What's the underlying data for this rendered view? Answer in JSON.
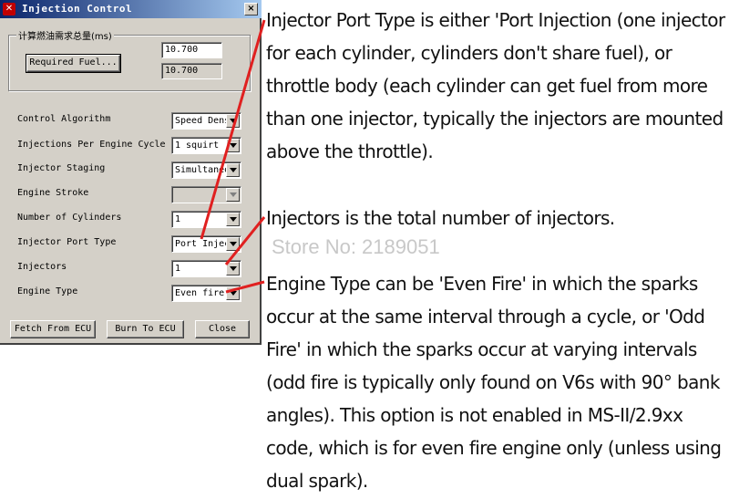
{
  "window": {
    "title": "Injection Control",
    "close_label": "×"
  },
  "required_fuel": {
    "group_label": "计算燃油需求总量(ms)",
    "button_label": "Required Fuel...",
    "value_editable": "10.700",
    "value_readonly": "10.700"
  },
  "settings": [
    {
      "label": "Control Algorithm",
      "value": "Speed Density"
    },
    {
      "label": "Injections Per Engine Cycle",
      "value": "1 squirt"
    },
    {
      "label": "Injector Staging",
      "value": "Simultaneous"
    },
    {
      "label": "Engine Stroke",
      "value": ""
    },
    {
      "label": "Number of Cylinders",
      "value": "1"
    },
    {
      "label": "Injector Port Type",
      "value": "Port Injection"
    },
    {
      "label": "Injectors",
      "value": "1"
    },
    {
      "label": "Engine Type",
      "value": "Even fire"
    }
  ],
  "buttons": {
    "fetch": "Fetch From ECU",
    "burn": "Burn To ECU",
    "close": "Close"
  },
  "annotations": {
    "port_type": "Injector Port Type is either 'Port Injection (one injector for each cylinder, cylinders don't share fuel), or throttle body (each cylinder can get fuel from more than one injector, typically the injectors are mounted above the throttle).",
    "injectors": "Injectors is the total number of injectors.",
    "watermark": "Store No: 2189051",
    "engine_type": "Engine Type can be 'Even Fire' in which the sparks occur at the same interval through a cycle, or 'Odd Fire' in which the sparks occur at varying intervals (odd fire is typically only found on V6s with 90° bank angles). This option is not enabled in MS-II/2.9xx code, which is for even fire engine only (unless using dual spark)."
  },
  "colors": {
    "title_bar": "#0a246a",
    "dialog_bg": "#d4d0c8",
    "arrow": "#e02020"
  },
  "icons": {
    "app": "megasquirt-app-icon",
    "combo_arrow": "chevron-down-icon"
  }
}
